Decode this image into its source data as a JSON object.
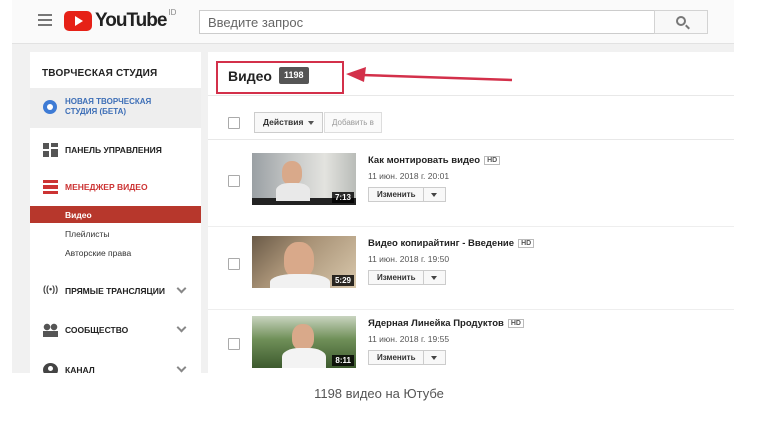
{
  "header": {
    "logo_text": "YouTube",
    "region": "ID",
    "search_placeholder": "Введите запрос"
  },
  "sidebar": {
    "title": "ТВОРЧЕСКАЯ СТУДИЯ",
    "beta_line1": "НОВАЯ ТВОРЧЕСКАЯ",
    "beta_line2": "СТУДИЯ (БЕТА)",
    "dashboard": "ПАНЕЛЬ УПРАВЛЕНИЯ",
    "video_manager": "МЕНЕДЖЕР ВИДЕО",
    "sub_videos": "Видео",
    "sub_playlists": "Плейлисты",
    "sub_copyright": "Авторские права",
    "live": "ПРЯМЫЕ ТРАНСЛЯЦИИ",
    "community": "СООБЩЕСТВО",
    "channel": "КАНАЛ"
  },
  "main": {
    "title": "Видео",
    "count": "1198",
    "actions_label": "Действия",
    "add_to_label": "Добавить в",
    "videos": [
      {
        "title": "Как монтировать видео",
        "badge": "HD",
        "date": "11 июн. 2018 г. 20:01",
        "duration": "7:13",
        "edit_label": "Изменить"
      },
      {
        "title": "Видео копирайтинг - Введение",
        "badge": "HD",
        "date": "11 июн. 2018 г. 19:50",
        "duration": "5:29",
        "edit_label": "Изменить"
      },
      {
        "title": "Ядерная Линейка Продуктов",
        "badge": "HD",
        "date": "11 июн. 2018 г. 19:55",
        "duration": "8:11",
        "edit_label": "Изменить"
      }
    ]
  },
  "caption": "1198 видео на Ютубе",
  "colors": {
    "accent_red": "#b7372c",
    "highlight": "#d3304a",
    "beta_blue": "#3e7bd5"
  }
}
